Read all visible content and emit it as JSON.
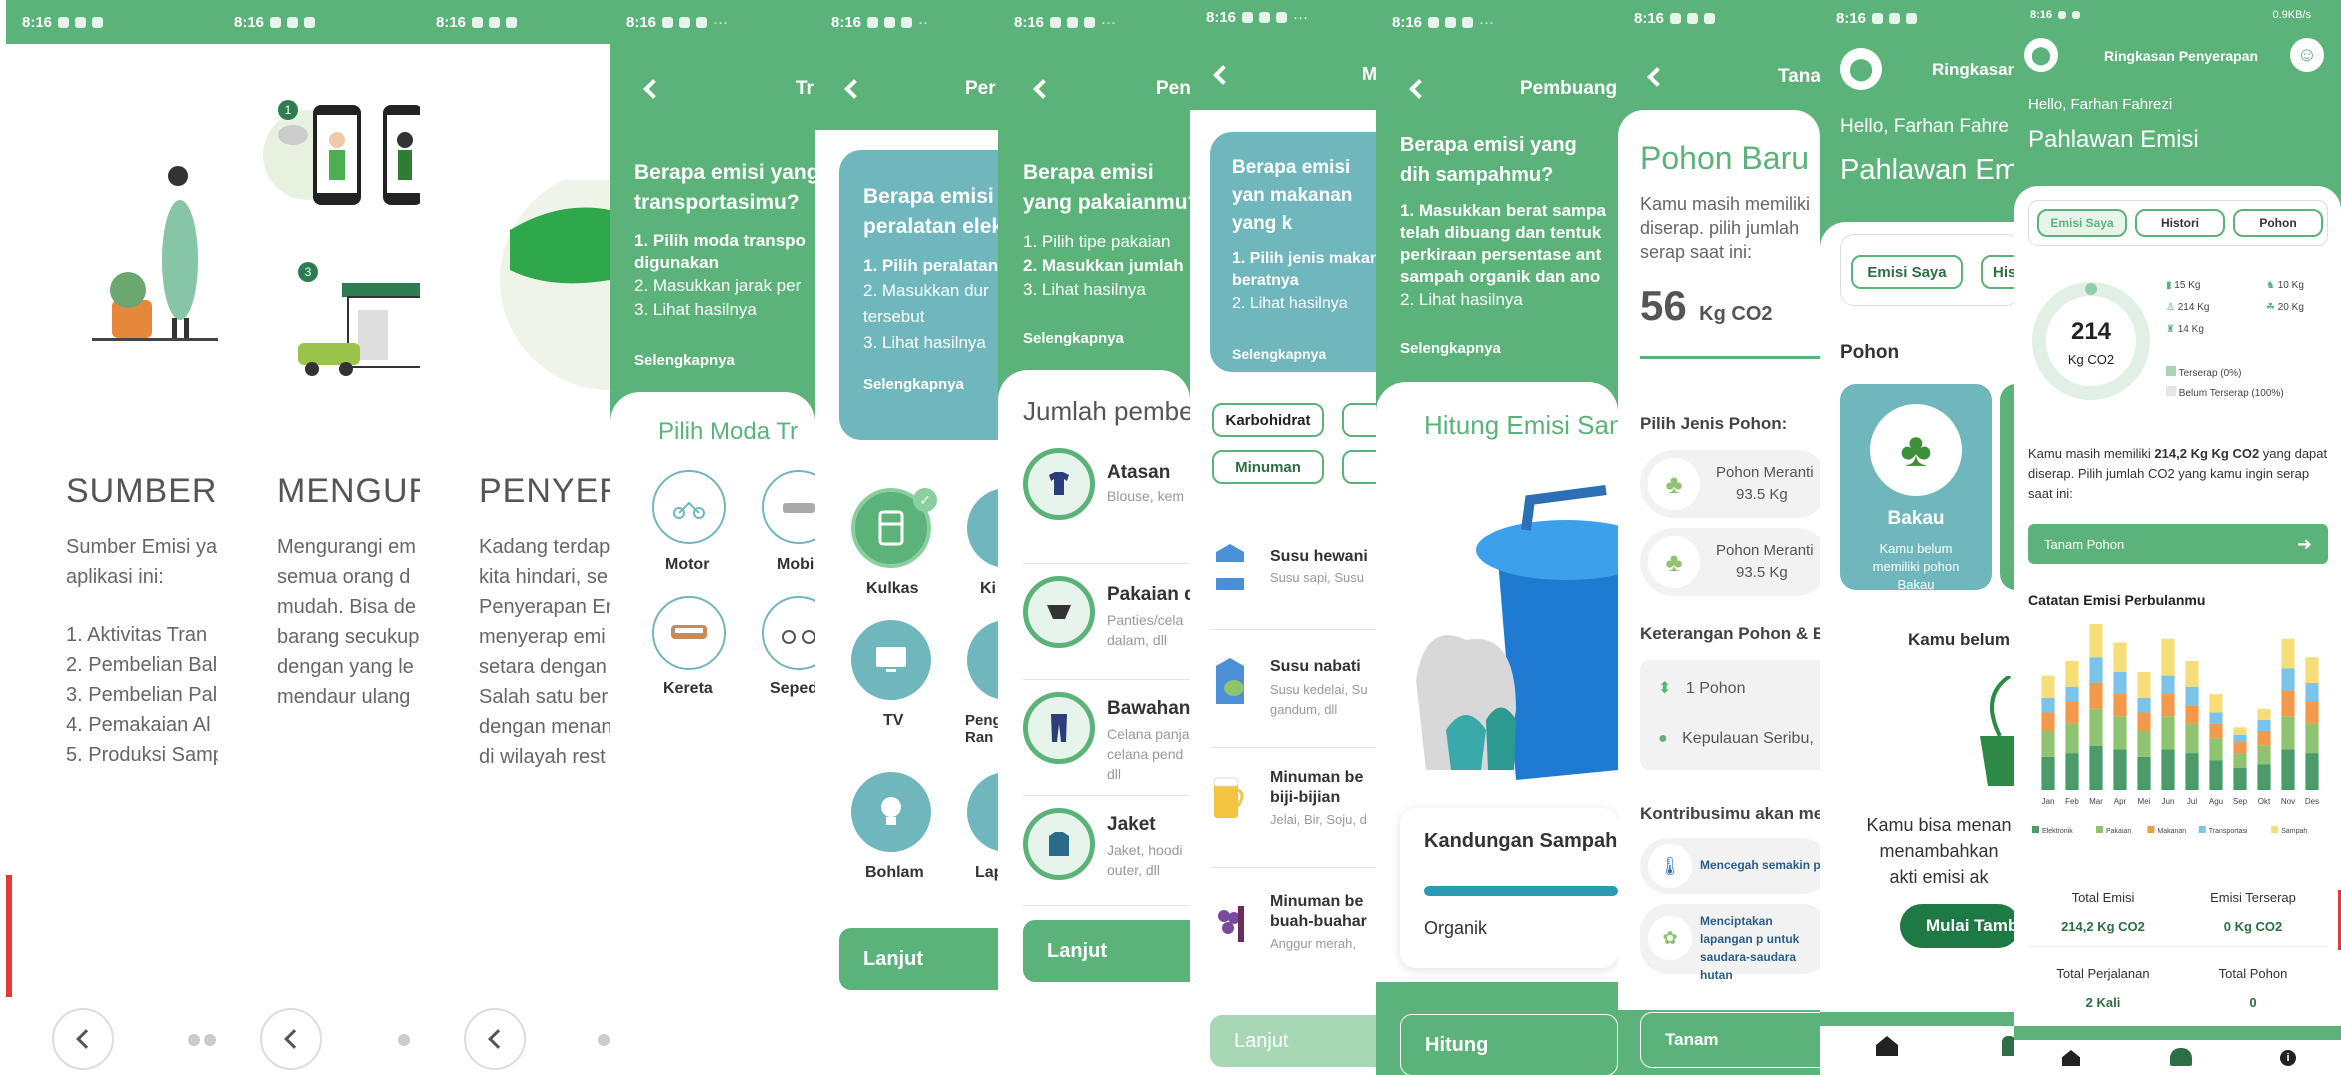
{
  "statusbar": {
    "time": "8:16"
  },
  "onboarding": [
    {
      "title": "SUMBER",
      "body": [
        "Sumber Emisi ya",
        "aplikasi ini:"
      ],
      "list": [
        "1.  Aktivitas Tran",
        "2. Pembelian Bal",
        "3. Pembelian Pal",
        "4. Pemakaian Al",
        "5. Produksi Samp"
      ]
    },
    {
      "title": "MENGUR",
      "body": [
        "Mengurangi em",
        "semua orang d",
        "mudah. Bisa de",
        "barang secukup",
        "dengan yang le",
        "mendaur ulang"
      ],
      "steps": [
        "1",
        "3"
      ]
    },
    {
      "title": "PENYER",
      "body": [
        "Kadang terdap",
        "kita hindari, se",
        "Penyerapan En",
        "menyerap emi",
        "setara dengan",
        "Salah satu ber",
        "dengan menan",
        "di wilayah rest"
      ]
    }
  ],
  "transport": {
    "header": "Tr",
    "question": "Berapa emisi yang transportasimu?",
    "step1": "1. Pilih moda transpo digunakan",
    "step2": "2. Masukkan jarak per",
    "step3": "3. Lihat hasilnya",
    "more": "Selengkapnya",
    "section": "Pilih Moda Tr",
    "options": [
      "Motor",
      "Mobi",
      "Kereta",
      "Seped"
    ]
  },
  "peralatan": {
    "header": "Per",
    "question": "Berapa emisi peralatan elek",
    "step1": "1. Pilih peralatan",
    "step2": "2. Masukkan dur tersebut",
    "step3": "3. Lihat hasilnya",
    "more": "Selengkapnya",
    "options": [
      "Kulkas",
      "Ki",
      "TV",
      "Peng Ran",
      "Bohlam",
      "Lap"
    ],
    "next": "Lanjut"
  },
  "pakaian": {
    "header": "Pen",
    "question": "Berapa emisi yang pakaianmu?",
    "step1": "1. Pilih tipe pakaian",
    "step2": "2. Masukkan jumlah",
    "step3": "3. Lihat hasilnya",
    "more": "Selengkapnya",
    "section": "Jumlah pembe",
    "items": [
      {
        "name": "Atasan",
        "desc": "Blouse, kem"
      },
      {
        "name": "Pakaian d",
        "desc": "Panties/cela dalam, dll"
      },
      {
        "name": "Bawahan",
        "desc": "Celana panja celana pend dll"
      },
      {
        "name": "Jaket",
        "desc": "Jaket, hoodi outer, dll"
      }
    ],
    "next": "Lanjut"
  },
  "makanan": {
    "header": "M",
    "question": "Berapa emisi yan makanan yang k",
    "step1": "1. Pilih jenis makan beratnya",
    "step2": "2. Lihat hasilnya",
    "more": "Selengkapnya",
    "chips": [
      "Karbohidrat",
      "Minuman"
    ],
    "items": [
      {
        "name": "Susu hewani",
        "desc": "Susu sapi, Susu"
      },
      {
        "name": "Susu nabati",
        "desc": "Susu kedelai, Su gandum, dll"
      },
      {
        "name": "Minuman be biji-bijian",
        "desc": "Jelai, Bir, Soju, d"
      },
      {
        "name": "Minuman be buah-buahar",
        "desc": "Anggur merah,"
      }
    ],
    "next": "Lanjut"
  },
  "sampah": {
    "header": "Pembuang",
    "question": "Berapa emisi yang dih sampahmu?",
    "step1": "1. Masukkan berat sampa telah dibuang dan tentuk perkiraan persentase ant sampah organik dan ano",
    "step2": "2. Lihat hasilnya",
    "more": "Selengkapnya",
    "section": "Hitung Emisi San",
    "card_title": "Kandungan Sampah",
    "card_label": "Organik",
    "button": "Hitung"
  },
  "pohon": {
    "header": "Tana",
    "title": "Pohon Baru",
    "desc": "Kamu masih memiliki diserap. pilih jumlah serap saat ini:",
    "value": "56",
    "unit": "Kg CO2",
    "choose": "Pilih Jenis Pohon:",
    "trees": [
      {
        "name": "Pohon Meranti",
        "val": "93.5 Kg"
      },
      {
        "name": "Pohon Meranti",
        "val": "93.5 Kg"
      }
    ],
    "info_title": "Keterangan Pohon & E",
    "count": "1 Pohon",
    "location": "Kepulauan Seribu,",
    "contrib_title": "Kontribusimu akan me",
    "contrib": [
      "Mencegah semakin para",
      "Menciptakan lapangan p untuk saudara-saudara hutan"
    ],
    "button": "Tanam"
  },
  "home": {
    "header": "Ringkasan",
    "hello": "Hello, Farhan Fahre",
    "title": "Pahlawan Em",
    "tabs": [
      "Emisi Saya",
      "His"
    ],
    "section": "Pohon",
    "card": {
      "name": "Bakau",
      "desc": "Kamu belum memiliki pohon Bakau"
    },
    "empty": "Kamu belum",
    "empty2": "Kamu bisa menan menambahkan akti emisi ak",
    "button": "Mulai Tamb"
  },
  "summary": {
    "header": "Ringkasan Penyerapan",
    "hello": "Hello, Farhan Fahrezi",
    "title": "Pahlawan Emisi",
    "tabs": [
      "Emisi Saya",
      "Histori",
      "Pohon"
    ],
    "total": "214",
    "unit": "Kg CO2",
    "legend": [
      {
        "v": "15 Kg"
      },
      {
        "v": "10 Kg"
      },
      {
        "v": "214 Kg"
      },
      {
        "v": "20 Kg"
      },
      {
        "v": "14 Kg"
      }
    ],
    "absorb": [
      "Terserap (0%)",
      "Belum Terserap (100%)"
    ],
    "desc_pre": "Kamu masih memiliki ",
    "desc_bold": "214,2 Kg Kg CO2",
    "desc_post": " yang dapat diserap. Pilih jumlah CO2 yang kamu ingin serap saat ini:",
    "plant": "Tanam Pohon",
    "chart_title": "Catatan Emisi Perbulanmu",
    "stats": [
      {
        "label": "Total Emisi",
        "value": "214,2 Kg CO2"
      },
      {
        "label": "Emisi Terserap",
        "value": "0 Kg CO2"
      },
      {
        "label": "Total Perjalanan",
        "value": "2 Kali"
      },
      {
        "label": "Total Pohon",
        "value": "0"
      }
    ],
    "network": "0.9KB/s"
  },
  "chart_data": {
    "type": "bar",
    "title": "Catatan Emisi Perbulanmu",
    "categories": [
      "Jan",
      "Feb",
      "Mar",
      "Apr",
      "Mei",
      "Jun",
      "Jul",
      "Agu",
      "Sep",
      "Okt",
      "Nov",
      "Des"
    ],
    "series": [
      {
        "name": "Elektronik",
        "color": "#4a9a6a",
        "values": [
          18,
          20,
          24,
          22,
          18,
          22,
          20,
          16,
          12,
          14,
          22,
          20
        ]
      },
      {
        "name": "Pakaian",
        "color": "#8fc36f",
        "values": [
          14,
          16,
          20,
          18,
          14,
          18,
          16,
          12,
          8,
          10,
          18,
          16
        ]
      },
      {
        "name": "Makanan",
        "color": "#f09a4a",
        "values": [
          10,
          12,
          14,
          12,
          10,
          12,
          10,
          8,
          6,
          8,
          14,
          12
        ]
      },
      {
        "name": "Transportasi",
        "color": "#7cc3ea",
        "values": [
          8,
          8,
          14,
          12,
          8,
          10,
          10,
          6,
          4,
          6,
          12,
          10
        ]
      },
      {
        "name": "Sampah",
        "color": "#f5de7a",
        "values": [
          12,
          14,
          18,
          16,
          14,
          20,
          14,
          10,
          4,
          6,
          16,
          14
        ]
      }
    ],
    "legend_position": "bottom"
  }
}
